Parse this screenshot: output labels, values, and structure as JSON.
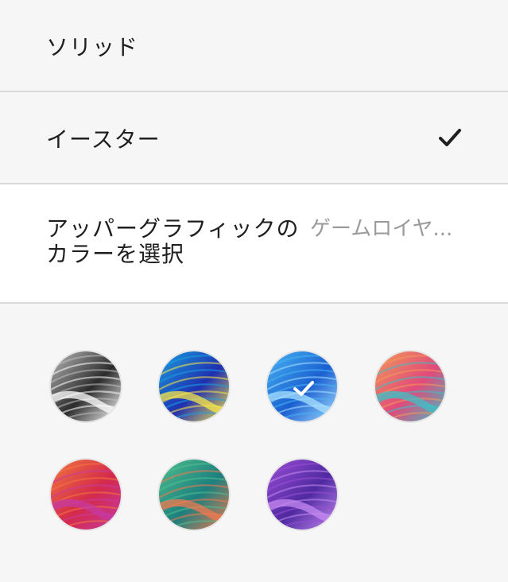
{
  "options": {
    "solid_label": "ソリッド",
    "easter_label": "イースター",
    "selected": "イースター"
  },
  "upper_graphic": {
    "label": "アッパーグラフィックのカラーを選択",
    "value": "ゲームロイヤ..."
  },
  "swatches": [
    {
      "name": "swatch-monochrome",
      "colors": [
        "#2b2b2b",
        "#bdbdbd",
        "#ffffff"
      ],
      "selected": false
    },
    {
      "name": "swatch-blue-yellow",
      "colors": [
        "#1f2fb0",
        "#19a0e0",
        "#f7e54a"
      ],
      "selected": false
    },
    {
      "name": "swatch-sky-blue",
      "colors": [
        "#1a5fd1",
        "#49b6f2",
        "#a7e0ff"
      ],
      "selected": true
    },
    {
      "name": "swatch-pink-coral",
      "colors": [
        "#e14a7a",
        "#f29a5a",
        "#3cc0c7"
      ],
      "selected": false
    },
    {
      "name": "swatch-red-magenta",
      "colors": [
        "#d42a4b",
        "#f2763f",
        "#c63aa2"
      ],
      "selected": false
    },
    {
      "name": "swatch-teal-green",
      "colors": [
        "#1d7f7e",
        "#4fc08f",
        "#f07a4f"
      ],
      "selected": false
    },
    {
      "name": "swatch-purple",
      "colors": [
        "#4e2aa0",
        "#9b4dd6",
        "#c58af0"
      ],
      "selected": false
    }
  ]
}
